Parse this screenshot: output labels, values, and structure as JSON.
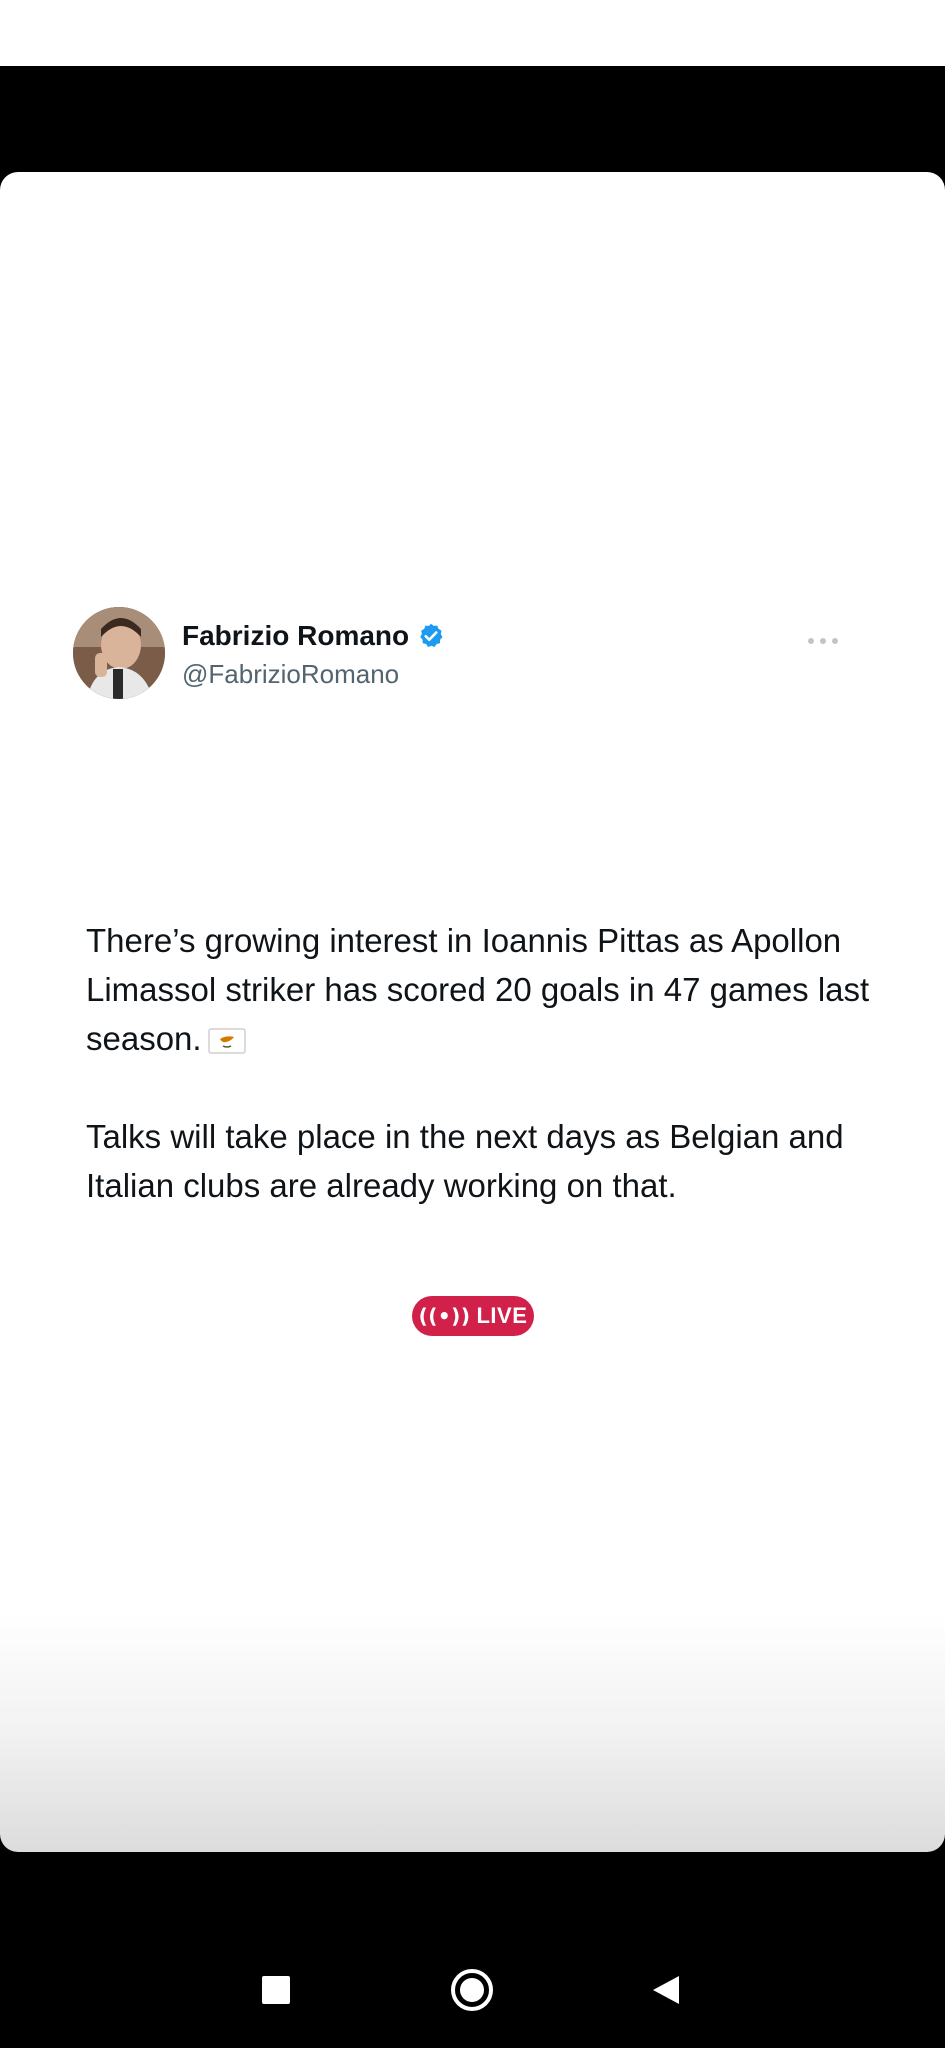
{
  "tweet": {
    "display_name": "Fabrizio Romano",
    "handle": "@FabrizioRomano",
    "paragraph1": "There’s growing interest in Ioannis Pittas as Apollon Limassol striker has scored 20 goals in 47 games last season.",
    "paragraph2": "Talks will take place in the next days as Belgian and Italian clubs are already working on that.",
    "flag_icon": "cyprus-flag-icon"
  },
  "live_badge": {
    "icon": "((•))",
    "label": "LIVE",
    "color": "#d1214a"
  },
  "colors": {
    "verified": "#1d9bf0",
    "text": "#0f1419",
    "secondary_text": "#536471"
  },
  "navbar": {
    "buttons": [
      "recents-button",
      "home-button",
      "back-button"
    ]
  }
}
